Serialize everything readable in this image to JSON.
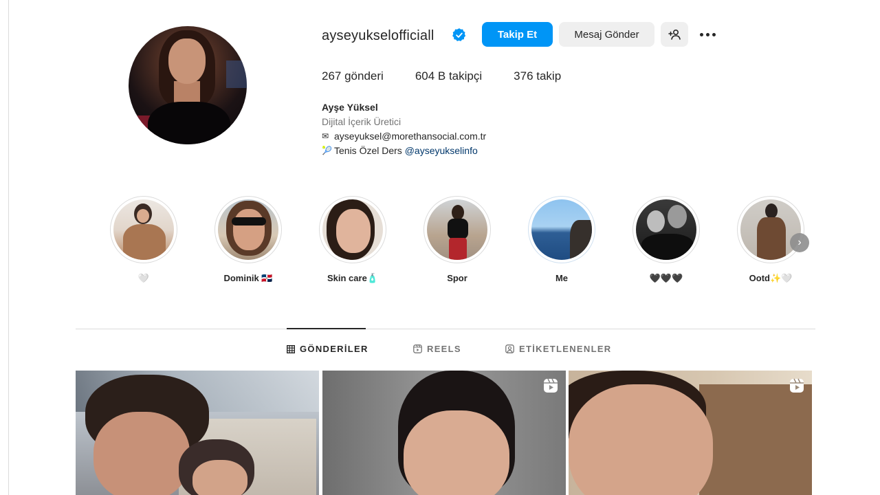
{
  "profile": {
    "username": "ayseyukselofficiall",
    "verified": true,
    "follow_label": "Takip Et",
    "message_label": "Mesaj Gönder",
    "stats": {
      "posts": "267 gönderi",
      "followers": "604 B takipçi",
      "following": "376 takip"
    },
    "bio": {
      "name": "Ayşe Yüksel",
      "category": "Dijital İçerik Üretici",
      "email_icon": "✉",
      "email": "ayseyuksel@morethansocial.com.tr",
      "tennis_icon": "🎾",
      "tennis_text": "Tenis Özel Ders ",
      "tennis_link": "@ayseyukselinfo"
    }
  },
  "highlights": [
    {
      "label": "🤍"
    },
    {
      "label": "Dominik 🇩🇴"
    },
    {
      "label": "Skin care🧴"
    },
    {
      "label": "Spor"
    },
    {
      "label": "Me"
    },
    {
      "label": "🖤🖤🖤"
    },
    {
      "label": "Ootd✨🤍"
    }
  ],
  "tabs": [
    {
      "label": "GÖNDERİLER",
      "active": true
    },
    {
      "label": "REELS",
      "active": false
    },
    {
      "label": "ETİKETLENENLER",
      "active": false
    }
  ],
  "colors": {
    "accent": "#0095f6",
    "verified": "#0095f6",
    "secondary_button": "#efefef",
    "link": "#00376b"
  }
}
